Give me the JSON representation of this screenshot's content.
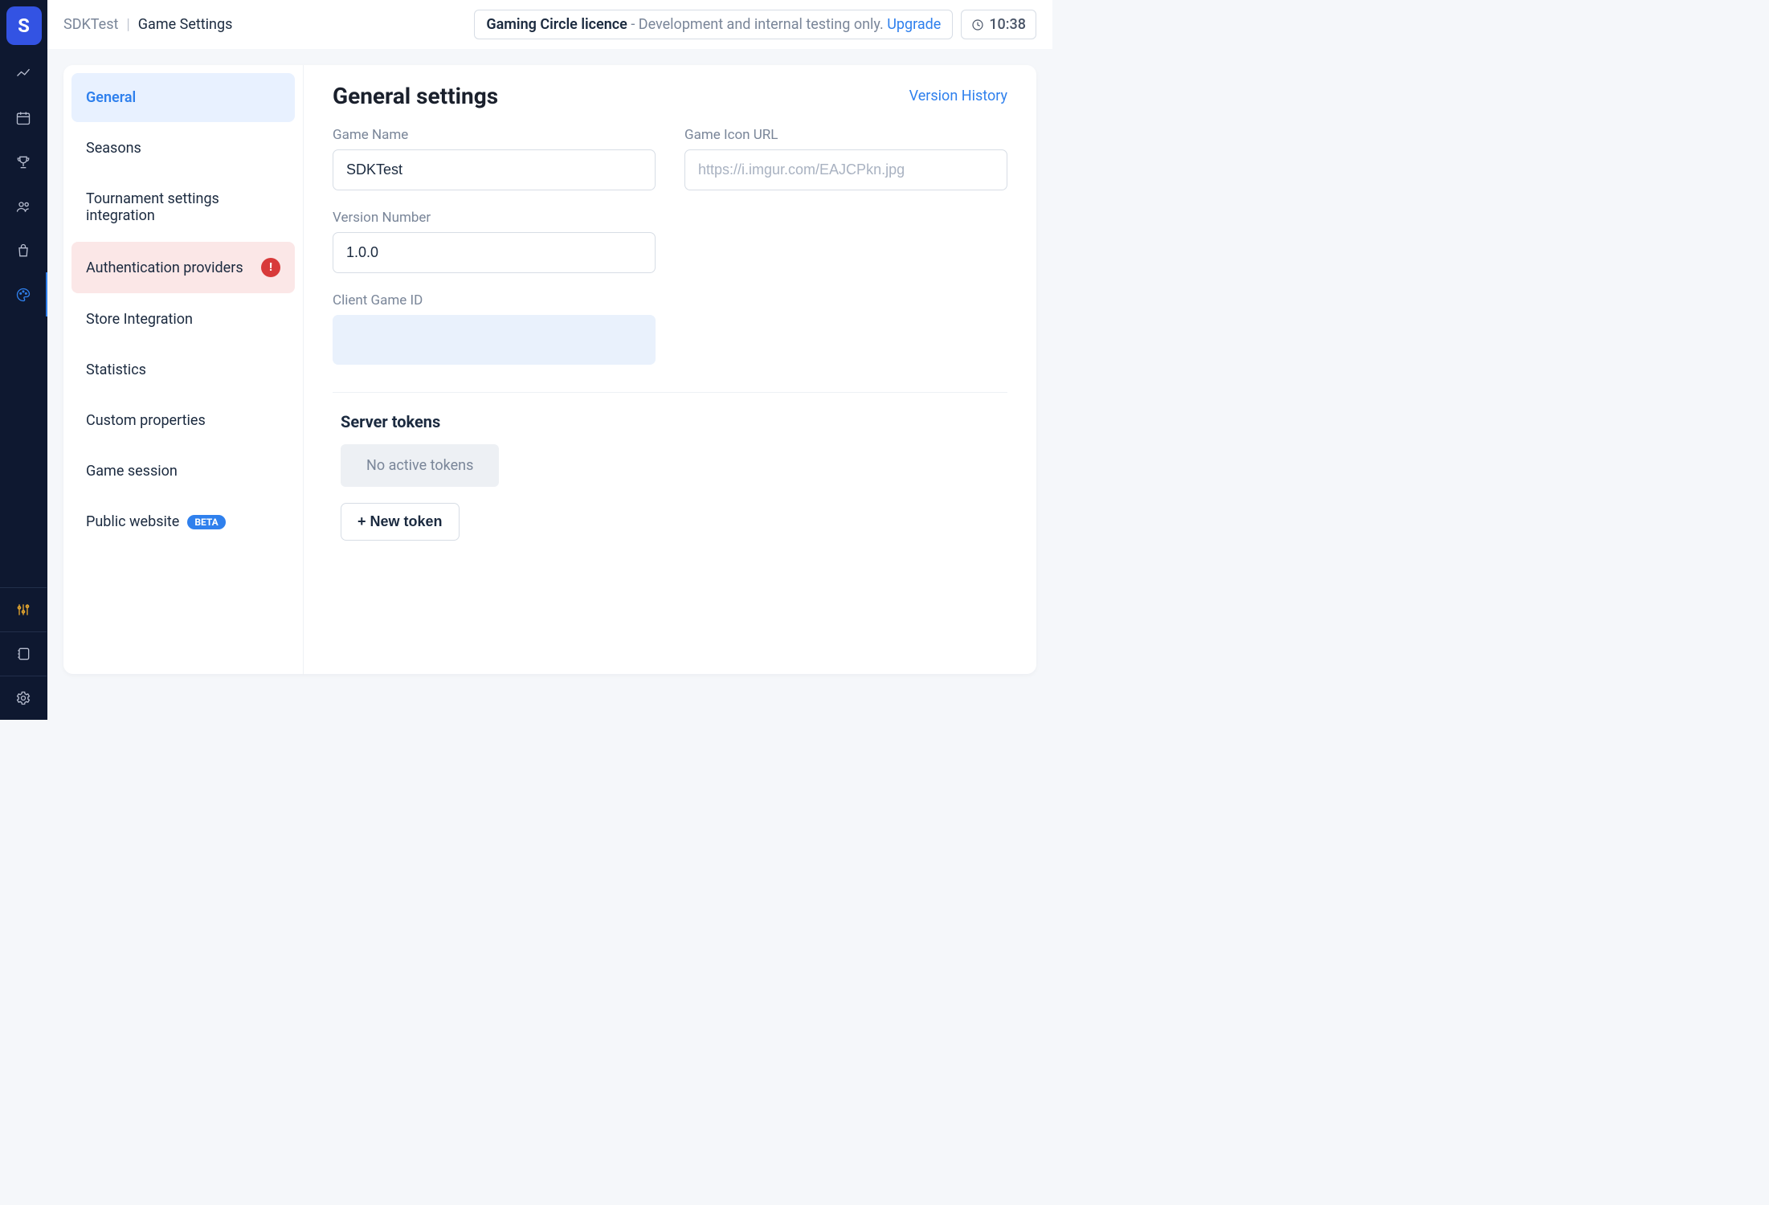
{
  "logo_letter": "S",
  "header": {
    "crumb_project": "SDKTest",
    "crumb_page": "Game Settings",
    "licence_title": "Gaming Circle licence",
    "licence_desc": " - Development and internal testing only. ",
    "licence_upgrade": "Upgrade",
    "clock": "10:38"
  },
  "settings_nav": [
    {
      "label": "General",
      "state": "active"
    },
    {
      "label": "Seasons",
      "state": ""
    },
    {
      "label": "Tournament settings integration",
      "state": ""
    },
    {
      "label": "Authentication providers",
      "state": "alert"
    },
    {
      "label": "Store Integration",
      "state": ""
    },
    {
      "label": "Statistics",
      "state": ""
    },
    {
      "label": "Custom properties",
      "state": ""
    },
    {
      "label": "Game session",
      "state": ""
    },
    {
      "label": "Public website",
      "state": "",
      "badge": "BETA"
    }
  ],
  "panel": {
    "title": "General settings",
    "version_history": "Version History",
    "labels": {
      "game_name": "Game Name",
      "game_icon": "Game Icon URL",
      "version": "Version Number",
      "client_game_id": "Client Game ID"
    },
    "values": {
      "game_name": "SDKTest",
      "version": "1.0.0"
    },
    "placeholders": {
      "game_icon": "https://i.imgur.com/EAJCPkn.jpg"
    },
    "tokens": {
      "title": "Server tokens",
      "empty": "No active tokens",
      "new_button": "+ New token"
    }
  }
}
